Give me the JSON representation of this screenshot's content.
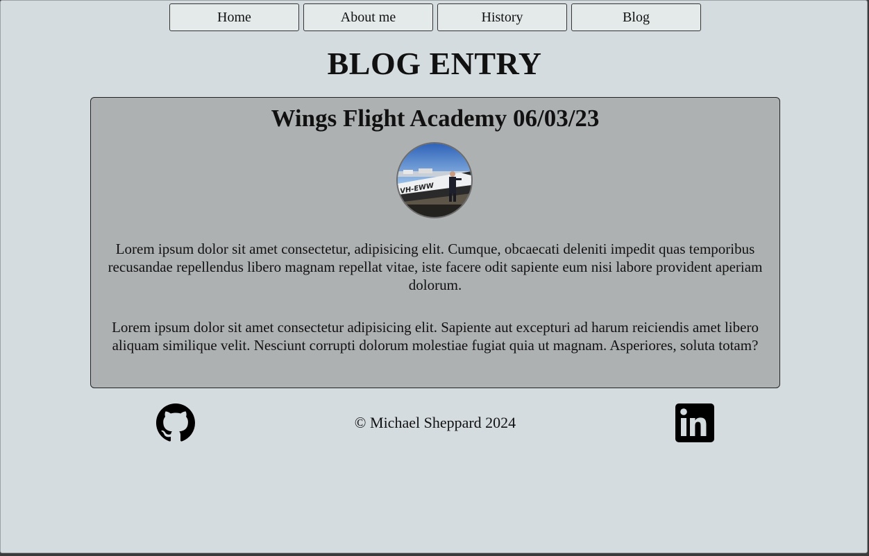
{
  "nav": {
    "items": [
      {
        "label": "Home"
      },
      {
        "label": "About me"
      },
      {
        "label": "History"
      },
      {
        "label": "Blog"
      }
    ]
  },
  "page": {
    "title": "BLOG ENTRY"
  },
  "entry": {
    "title": "Wings Flight Academy 06/03/23",
    "photo_tail": "VH-EWW",
    "paragraphs": [
      "Lorem ipsum dolor sit amet consectetur, adipisicing elit. Cumque, obcaecati deleniti impedit quas temporibus recusandae repellendus libero magnam repellat vitae, iste facere odit sapiente eum nisi labore provident aperiam dolorum.",
      "Lorem ipsum dolor sit amet consectetur adipisicing elit. Sapiente aut excepturi ad harum reiciendis amet libero aliquam similique velit. Nesciunt corrupti dolorum molestiae fugiat quia ut magnam. Asperiores, soluta totam?"
    ]
  },
  "footer": {
    "copyright": "© Michael Sheppard 2024",
    "icons": [
      "github-icon",
      "linkedin-icon"
    ]
  },
  "colors": {
    "page_bg": "#d5dcdf",
    "card_bg": "#aeb1b2",
    "nav_bg": "#e3eae9"
  }
}
